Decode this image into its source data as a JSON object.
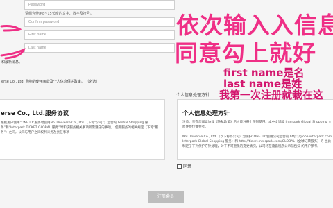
{
  "form": {
    "password_placeholder": "Password",
    "password_hint": "请组合使用8~15长度的文字、数字及符号。",
    "confirm_password_placeholder": "Confirm password",
    "first_name_placeholder": "First name",
    "last_name_placeholder": "Last name"
  },
  "consent": {
    "marketing_fragment": "和最新消息。",
    "agree_text": "erse Co., Ltd. 购物的使用条款及个人信息保护政策。 （必选）",
    "terms_heading": "erse Co., Ltd.服务协议",
    "terms_body": "根据用户使用“ONE ID”服务时使用Nol Universe Co., Ltd.（下称“公司”）运营的 Global Shopping 服务”和“Interpark TICKET GLOBAL 服务”时和该服务相关事项所需遵守的事项。 使用服务的相关规定（下称“服务”）之间，公司与用户之间权利义务及责任事项",
    "privacy_label": "个人信息处理方针",
    "privacy_heading": "个人信息处理方针",
    "privacy_body_1": "注意：只有您阅读协议《隐私政策》后才能注册上限制使用。本中文译版 Interpark Global Shopping 文原件版仅做参考。",
    "privacy_body_2": "Nol Universe Co., Ltd.（以下称作公司）为保护“ONE ID”使用公司运营的 http://globalinterpark.com Interpark Global Shopping 服务）和 http://ticket.interpark.com/GLOBAL（全球订票服务）的 由此制定了下列保护方针处理，对于不可避免的变更情况，公司将在遵循程序公示前告知 的用户参考。",
    "agree_checkbox": "同意"
  },
  "submit_label": "注册会员",
  "annotation": {
    "big_line_1": "依次输入入信息",
    "big_line_2": "同意勾上就好",
    "small_line_1": "first name是名",
    "small_line_2": "last name是姓",
    "small_line_3": "我第一次注册就栽在这"
  },
  "colors": {
    "annotation_pink": "#ef2f86",
    "button_gray": "#bdbdbd"
  }
}
